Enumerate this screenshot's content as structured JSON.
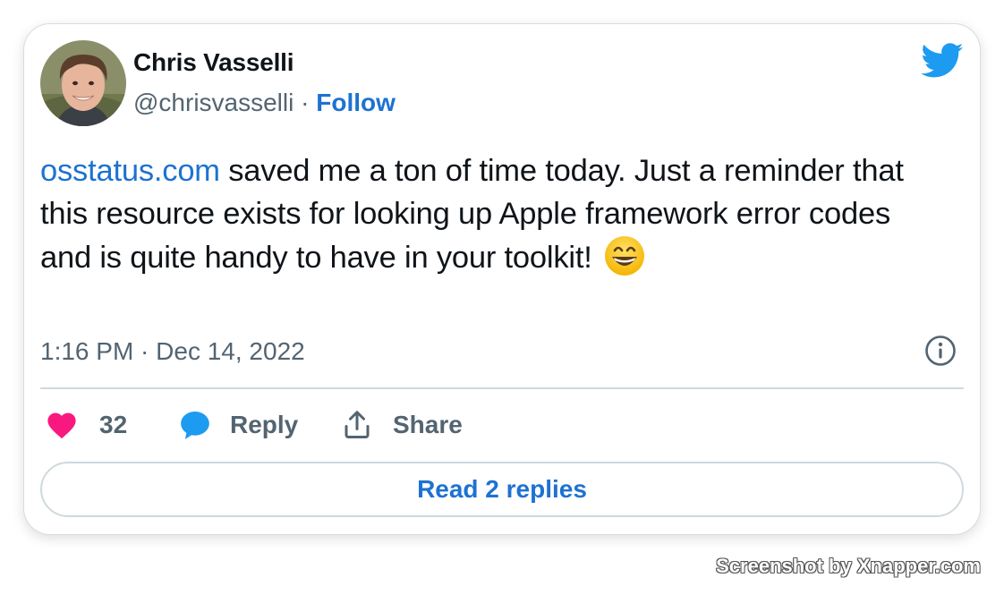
{
  "tweet": {
    "author": {
      "name": "Chris Vasselli",
      "handle": "@chrisvasselli",
      "separator": " · ",
      "follow_label": "Follow"
    },
    "text": {
      "link": "osstatus.com",
      "body": " saved me a ton of time today. Just a reminder that this resource exists for looking up Apple framework error codes and is quite handy to have in your toolkit! ",
      "emoji": "grinning-face-with-smiling-eyes"
    },
    "timestamp": "1:16 PM · Dec 14, 2022",
    "actions": {
      "like_count": "32",
      "reply_label": "Reply",
      "share_label": "Share"
    },
    "read_replies_label": "Read 2 replies"
  },
  "watermark": "Screenshot by Xnapper.com",
  "icons": {
    "logo": "twitter-bird-icon",
    "like": "heart-icon",
    "reply": "speech-bubble-icon",
    "share": "share-upload-icon",
    "info": "info-circle-icon"
  },
  "colors": {
    "link": "#1d72d2",
    "twitter_blue": "#1d9bf0",
    "heart": "#f91880",
    "muted_text": "#536471",
    "primary_text": "#0f1419",
    "border": "#cfd9de"
  }
}
